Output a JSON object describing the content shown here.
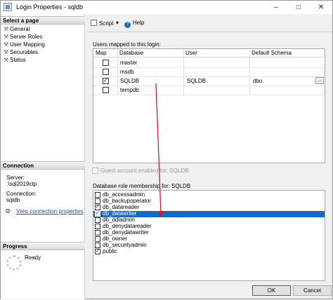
{
  "window": {
    "title": "Login Properties - sqldb",
    "minimize": "–",
    "maximize": "□",
    "close": "✕"
  },
  "left": {
    "select_page_header": "Select a page",
    "pages": [
      "General",
      "Server Roles",
      "User Mapping",
      "Securables",
      "Status"
    ],
    "connection_header": "Connection",
    "server_label": "Server:",
    "server_value": ".\\sql2019ctp",
    "connection_label": "Connection:",
    "connection_value": "sqldb",
    "view_connection_link": "View connection properties",
    "progress_header": "Progress",
    "progress_status": "Ready"
  },
  "toolbar": {
    "script_label": "Script",
    "script_dropdown": "▾",
    "help_label": "Help",
    "help_glyph": "?"
  },
  "users_mapped": {
    "label": "Users mapped to this login:",
    "columns": [
      "Map",
      "Database",
      "User",
      "Default Schema"
    ],
    "rows": [
      {
        "map": false,
        "database": "master",
        "user": "",
        "schema": ""
      },
      {
        "map": false,
        "database": "msdb",
        "user": "",
        "schema": ""
      },
      {
        "map": true,
        "database": "SQLDB",
        "user": "SQLDB",
        "schema": "dbo",
        "ellipsis": "..."
      },
      {
        "map": false,
        "database": "tempdb",
        "user": "",
        "schema": ""
      }
    ]
  },
  "guest_label": "Guest account enabled for: SQLDB",
  "role_membership": {
    "label": "Database role membership for: SQLDB",
    "roles": [
      {
        "name": "db_accessadmin",
        "checked": false,
        "selected": false
      },
      {
        "name": "db_backupoperator",
        "checked": false,
        "selected": false
      },
      {
        "name": "db_datareader",
        "checked": true,
        "selected": false
      },
      {
        "name": "db_datawriter",
        "checked": true,
        "selected": true
      },
      {
        "name": "db_ddladmin",
        "checked": false,
        "selected": false
      },
      {
        "name": "db_denydatareader",
        "checked": false,
        "selected": false
      },
      {
        "name": "db_denydatawriter",
        "checked": false,
        "selected": false
      },
      {
        "name": "db_owner",
        "checked": false,
        "selected": false
      },
      {
        "name": "db_securityadmin",
        "checked": false,
        "selected": false
      },
      {
        "name": "public",
        "checked": true,
        "selected": false
      }
    ]
  },
  "buttons": {
    "ok": "OK",
    "cancel": "Cancel"
  },
  "colors": {
    "selection": "#0a6ed1",
    "annotation_arrow": "#c0202a",
    "link": "#1a4fb5"
  }
}
